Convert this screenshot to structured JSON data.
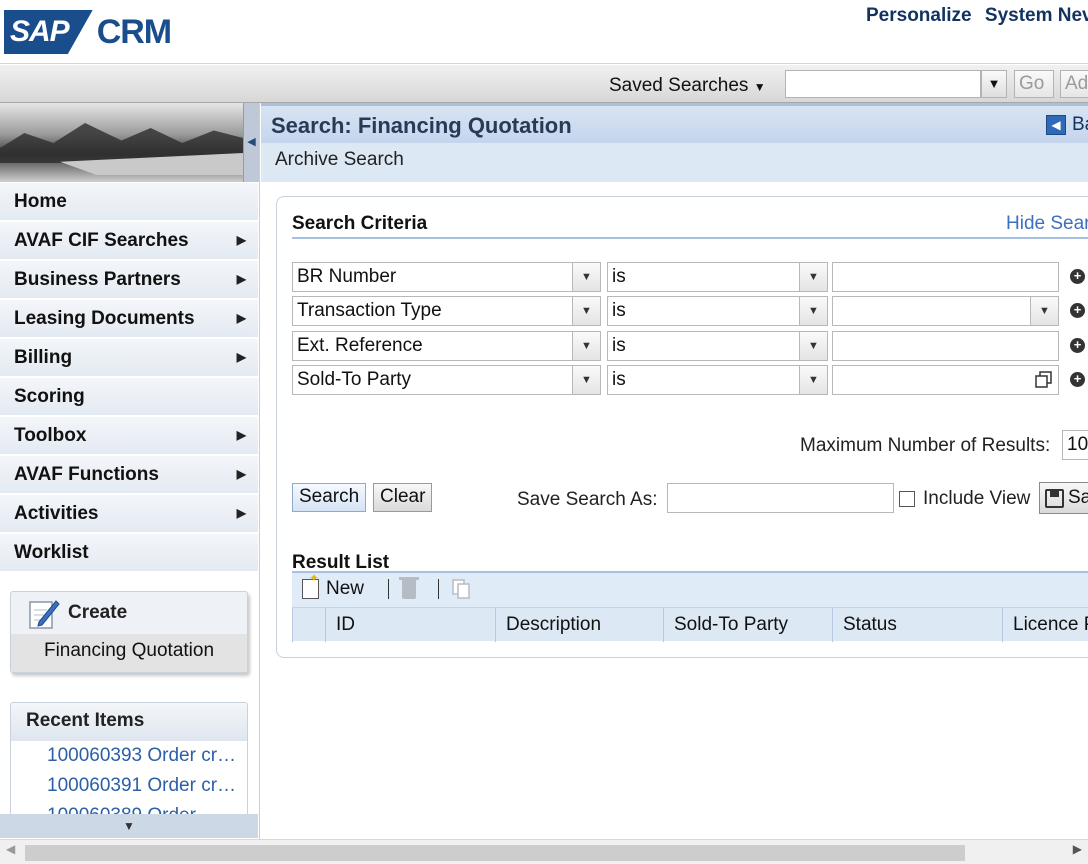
{
  "header": {
    "logo_sap": "SAP",
    "logo_crm": "CRM",
    "links": [
      "Personalize",
      "System Nev"
    ]
  },
  "toolbar": {
    "saved_searches": "Saved Searches",
    "saved_value": "",
    "go_label": "Go",
    "advanced_label": "Ad"
  },
  "nav": {
    "items": [
      {
        "label": "Home",
        "has_submenu": false
      },
      {
        "label": "AVAF CIF Searches",
        "has_submenu": true
      },
      {
        "label": "Business Partners",
        "has_submenu": true
      },
      {
        "label": "Leasing Documents",
        "has_submenu": true
      },
      {
        "label": "Billing",
        "has_submenu": true
      },
      {
        "label": "Scoring",
        "has_submenu": false
      },
      {
        "label": "Toolbox",
        "has_submenu": true
      },
      {
        "label": "AVAF Functions",
        "has_submenu": true
      },
      {
        "label": "Activities",
        "has_submenu": true
      },
      {
        "label": "Worklist",
        "has_submenu": false
      }
    ],
    "create": {
      "title": "Create",
      "link": "Financing Quotation"
    },
    "recent": {
      "title": "Recent Items",
      "items": [
        "100060393 Order cr…",
        "100060391 Order cr…",
        "100060389 Order…"
      ]
    }
  },
  "main": {
    "title": "Search: Financing Quotation",
    "back_label": "Ba",
    "subheader": "Archive Search",
    "criteria_title": "Search Criteria",
    "hide_link": "Hide Sear",
    "criteria": [
      {
        "field": "BR Number",
        "operator": "is",
        "value": "",
        "value_control": "text"
      },
      {
        "field": "Transaction Type",
        "operator": "is",
        "value": "",
        "value_control": "dropdown"
      },
      {
        "field": "Ext. Reference",
        "operator": "is",
        "value": "",
        "value_control": "text"
      },
      {
        "field": "Sold-To Party",
        "operator": "is",
        "value": "",
        "value_control": "lookup"
      }
    ],
    "max_results_label": "Maximum Number of Results:",
    "max_results_value": "10",
    "search_button": "Search",
    "clear_button": "Clear",
    "save_search_label": "Save Search As:",
    "save_search_value": "",
    "include_view_label": "Include View",
    "save_button": "Sa",
    "result_title": "Result List",
    "new_button": "New",
    "columns": [
      "ID",
      "Description",
      "Sold-To Party",
      "Status",
      "Licence P"
    ]
  },
  "colors": {
    "brand": "#1a4d8c",
    "header_blue": "#c4d5ec",
    "link": "#3d6fc0"
  }
}
